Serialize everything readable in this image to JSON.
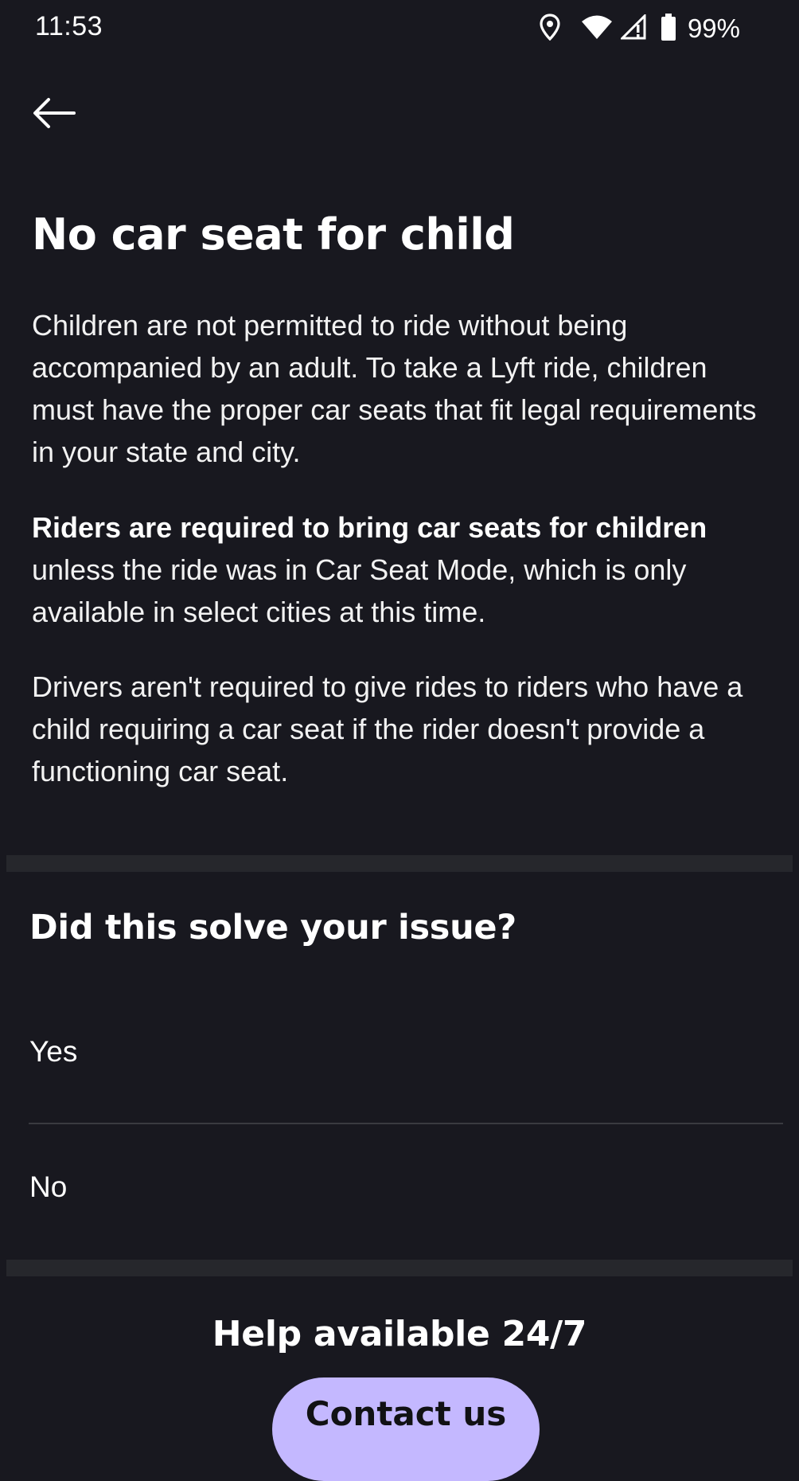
{
  "status_bar": {
    "time": "11:53",
    "icons": [
      "location-icon",
      "wifi-icon",
      "signal-icon",
      "battery-icon"
    ],
    "battery": "99%"
  },
  "header": {
    "back_icon": "arrow-left-icon"
  },
  "article": {
    "title": "No car seat for child",
    "paragraph1": "Children are not permitted to ride without being accompanied by an adult. To take a Lyft ride, children must have the proper car seats that fit legal requirements in your state and city.",
    "paragraph2_bold": "Riders are required to bring car seats for children",
    "paragraph2_rest": " unless the ride was in Car Seat Mode, which is only available in select cities at this time.",
    "paragraph3": "Drivers aren't required to give rides to riders who have a child requiring a car seat if the rider doesn't provide a functioning car seat."
  },
  "feedback": {
    "question": "Did this solve your issue?",
    "options": [
      {
        "label": "Yes"
      },
      {
        "label": "No"
      }
    ]
  },
  "help": {
    "text": "Help available 24/7",
    "button_label": "Contact us"
  },
  "colors": {
    "background": "#18181f",
    "band": "#26272c",
    "accent": "#c4b8ff"
  }
}
